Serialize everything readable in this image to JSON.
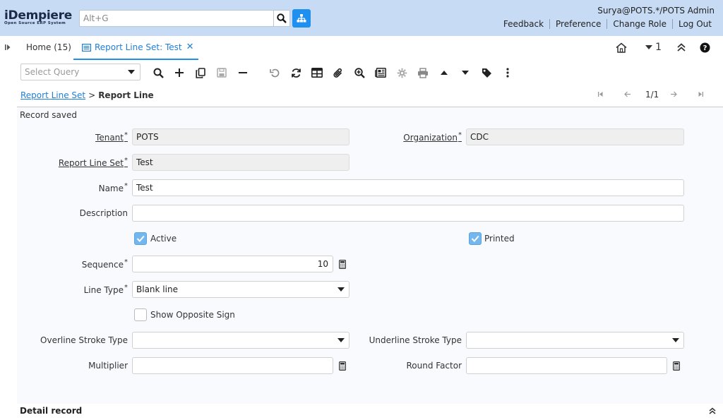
{
  "header": {
    "logo_text": "iDempiere",
    "logo_sub": "Open Source ERP System",
    "search_placeholder": "Alt+G",
    "user": "Surya@POTS.*/POTS Admin",
    "links": [
      "Feedback",
      "Preference",
      "Change Role",
      "Log Out"
    ]
  },
  "tabs": {
    "home": "Home (15)",
    "active": "Report Line Set: Test",
    "close": "✕",
    "window_count": "1"
  },
  "toolbar": {
    "query_placeholder": "Select Query"
  },
  "breadcrumb": {
    "parent": "Report Line Set",
    "separator": ">",
    "current": "Report Line",
    "record_pos": "1/1"
  },
  "form": {
    "status": "Record saved",
    "tenant_label": "Tenant",
    "tenant_value": "POTS",
    "org_label": "Organization",
    "org_value": "CDC",
    "lineset_label": "Report Line Set",
    "lineset_value": "Test",
    "name_label": "Name",
    "name_value": "Test",
    "description_label": "Description",
    "description_value": "",
    "active_label": "Active",
    "active_checked": true,
    "printed_label": "Printed",
    "printed_checked": true,
    "sequence_label": "Sequence",
    "sequence_value": "10",
    "linetype_label": "Line Type",
    "linetype_value": "Blank line",
    "opposite_label": "Show Opposite Sign",
    "opposite_checked": false,
    "overline_label": "Overline Stroke Type",
    "overline_value": "",
    "underline_label": "Underline Stroke Type",
    "underline_value": "",
    "multiplier_label": "Multiplier",
    "multiplier_value": "",
    "round_label": "Round Factor",
    "round_value": "",
    "required_mark": "*"
  },
  "detail": {
    "title": "Detail record"
  },
  "colors": {
    "header_bg": "#c7dcf4",
    "accent": "#1f8ff0",
    "checkbox_on": "#74b7ef"
  }
}
